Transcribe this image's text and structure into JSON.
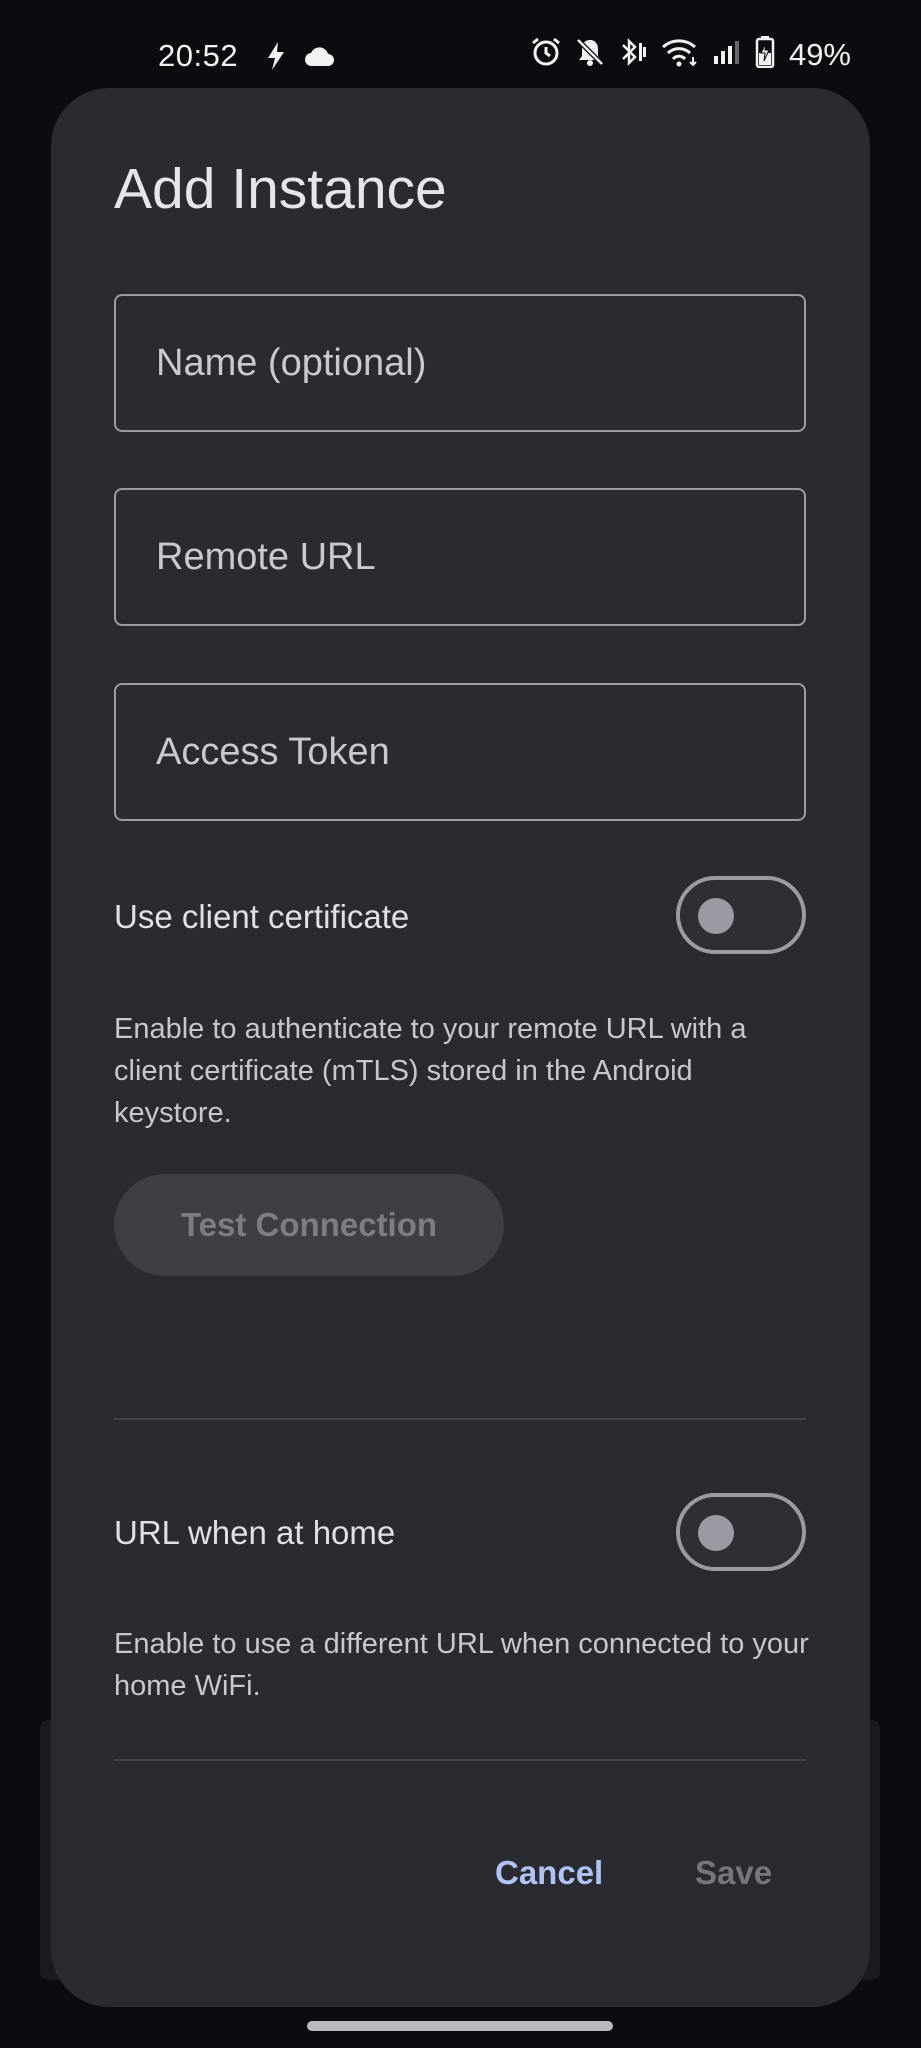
{
  "status_bar": {
    "time": "20:52",
    "battery_percent": "49%",
    "icons": [
      "flash-icon",
      "cloud-icon",
      "alarm-icon",
      "bell-off-icon",
      "bluetooth-icon",
      "wifi-icon",
      "signal-icon",
      "battery-charging-icon"
    ]
  },
  "dialog": {
    "title": "Add Instance",
    "fields": {
      "name": {
        "placeholder": "Name (optional)",
        "value": ""
      },
      "remote_url": {
        "placeholder": "Remote URL",
        "value": ""
      },
      "access_token": {
        "placeholder": "Access Token",
        "value": ""
      }
    },
    "client_cert": {
      "label": "Use client certificate",
      "enabled": false,
      "help": "Enable to authenticate to your remote URL with a client certificate (mTLS) stored in the Android keystore."
    },
    "test_button_label": "Test Connection",
    "home_url": {
      "label": "URL when at home",
      "enabled": false,
      "help": "Enable to use a different URL when connected to your home WiFi."
    },
    "cancel_label": "Cancel",
    "save_label": "Save"
  },
  "colors": {
    "dialog_bg": "#2a2b30",
    "accent": "#b2c3f5",
    "outline": "#9b9ca3",
    "disabled_text": "#76777d"
  }
}
